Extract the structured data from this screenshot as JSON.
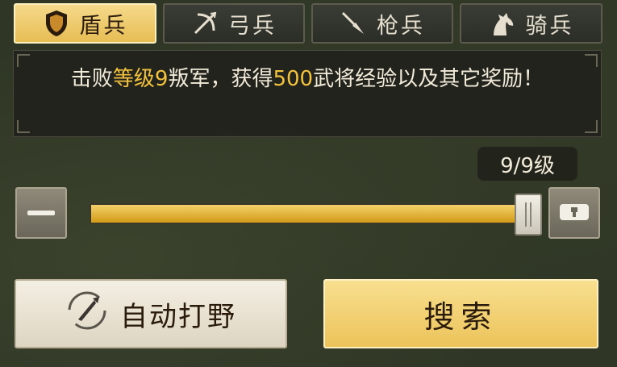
{
  "tabs": [
    {
      "label": "盾兵",
      "icon": "shield-icon",
      "active": true
    },
    {
      "label": "弓兵",
      "icon": "bow-icon",
      "active": false
    },
    {
      "label": "枪兵",
      "icon": "spear-icon",
      "active": false
    },
    {
      "label": "骑兵",
      "icon": "horse-icon",
      "active": false
    }
  ],
  "info": {
    "t1": "击败",
    "h1": "等级9",
    "t2": "叛军，获得",
    "h2": "500",
    "t3": "武将经验以及其它奖励！"
  },
  "level": {
    "current": 9,
    "max": 9,
    "text": "9/9级"
  },
  "slider": {
    "fraction": 1.0
  },
  "buttons": {
    "auto_label": "自动打野",
    "search_label": "搜索"
  },
  "colors": {
    "accent": "#f2c23e",
    "active_tab": "#e7bd55"
  }
}
